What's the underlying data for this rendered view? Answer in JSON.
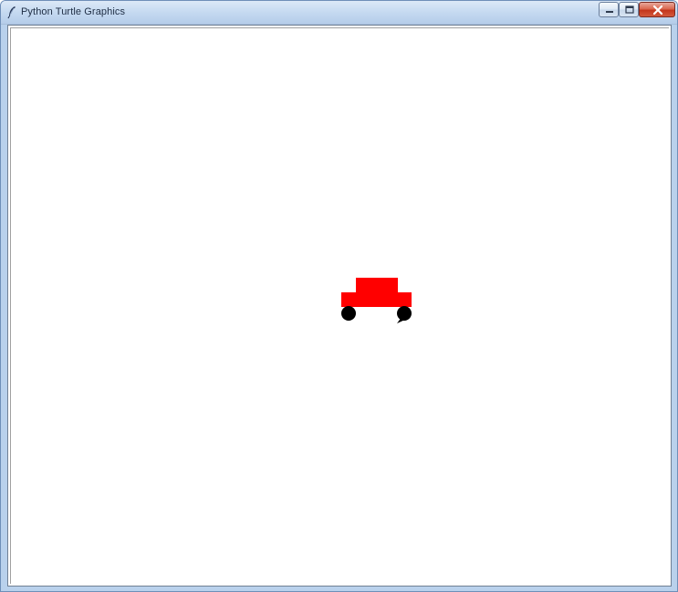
{
  "window": {
    "title": "Python Turtle Graphics",
    "icon": "feather-icon",
    "controls": [
      "minimize-icon",
      "maximize-icon",
      "close-icon"
    ]
  },
  "canvas": {
    "background": "#ffffff",
    "shapes": [
      {
        "kind": "car-roof",
        "color": "#ff0000"
      },
      {
        "kind": "car-body",
        "color": "#ff0000"
      },
      {
        "kind": "wheel",
        "color": "#000000"
      },
      {
        "kind": "wheel",
        "color": "#000000"
      },
      {
        "kind": "turtle-cursor",
        "color": "#000000"
      }
    ]
  }
}
